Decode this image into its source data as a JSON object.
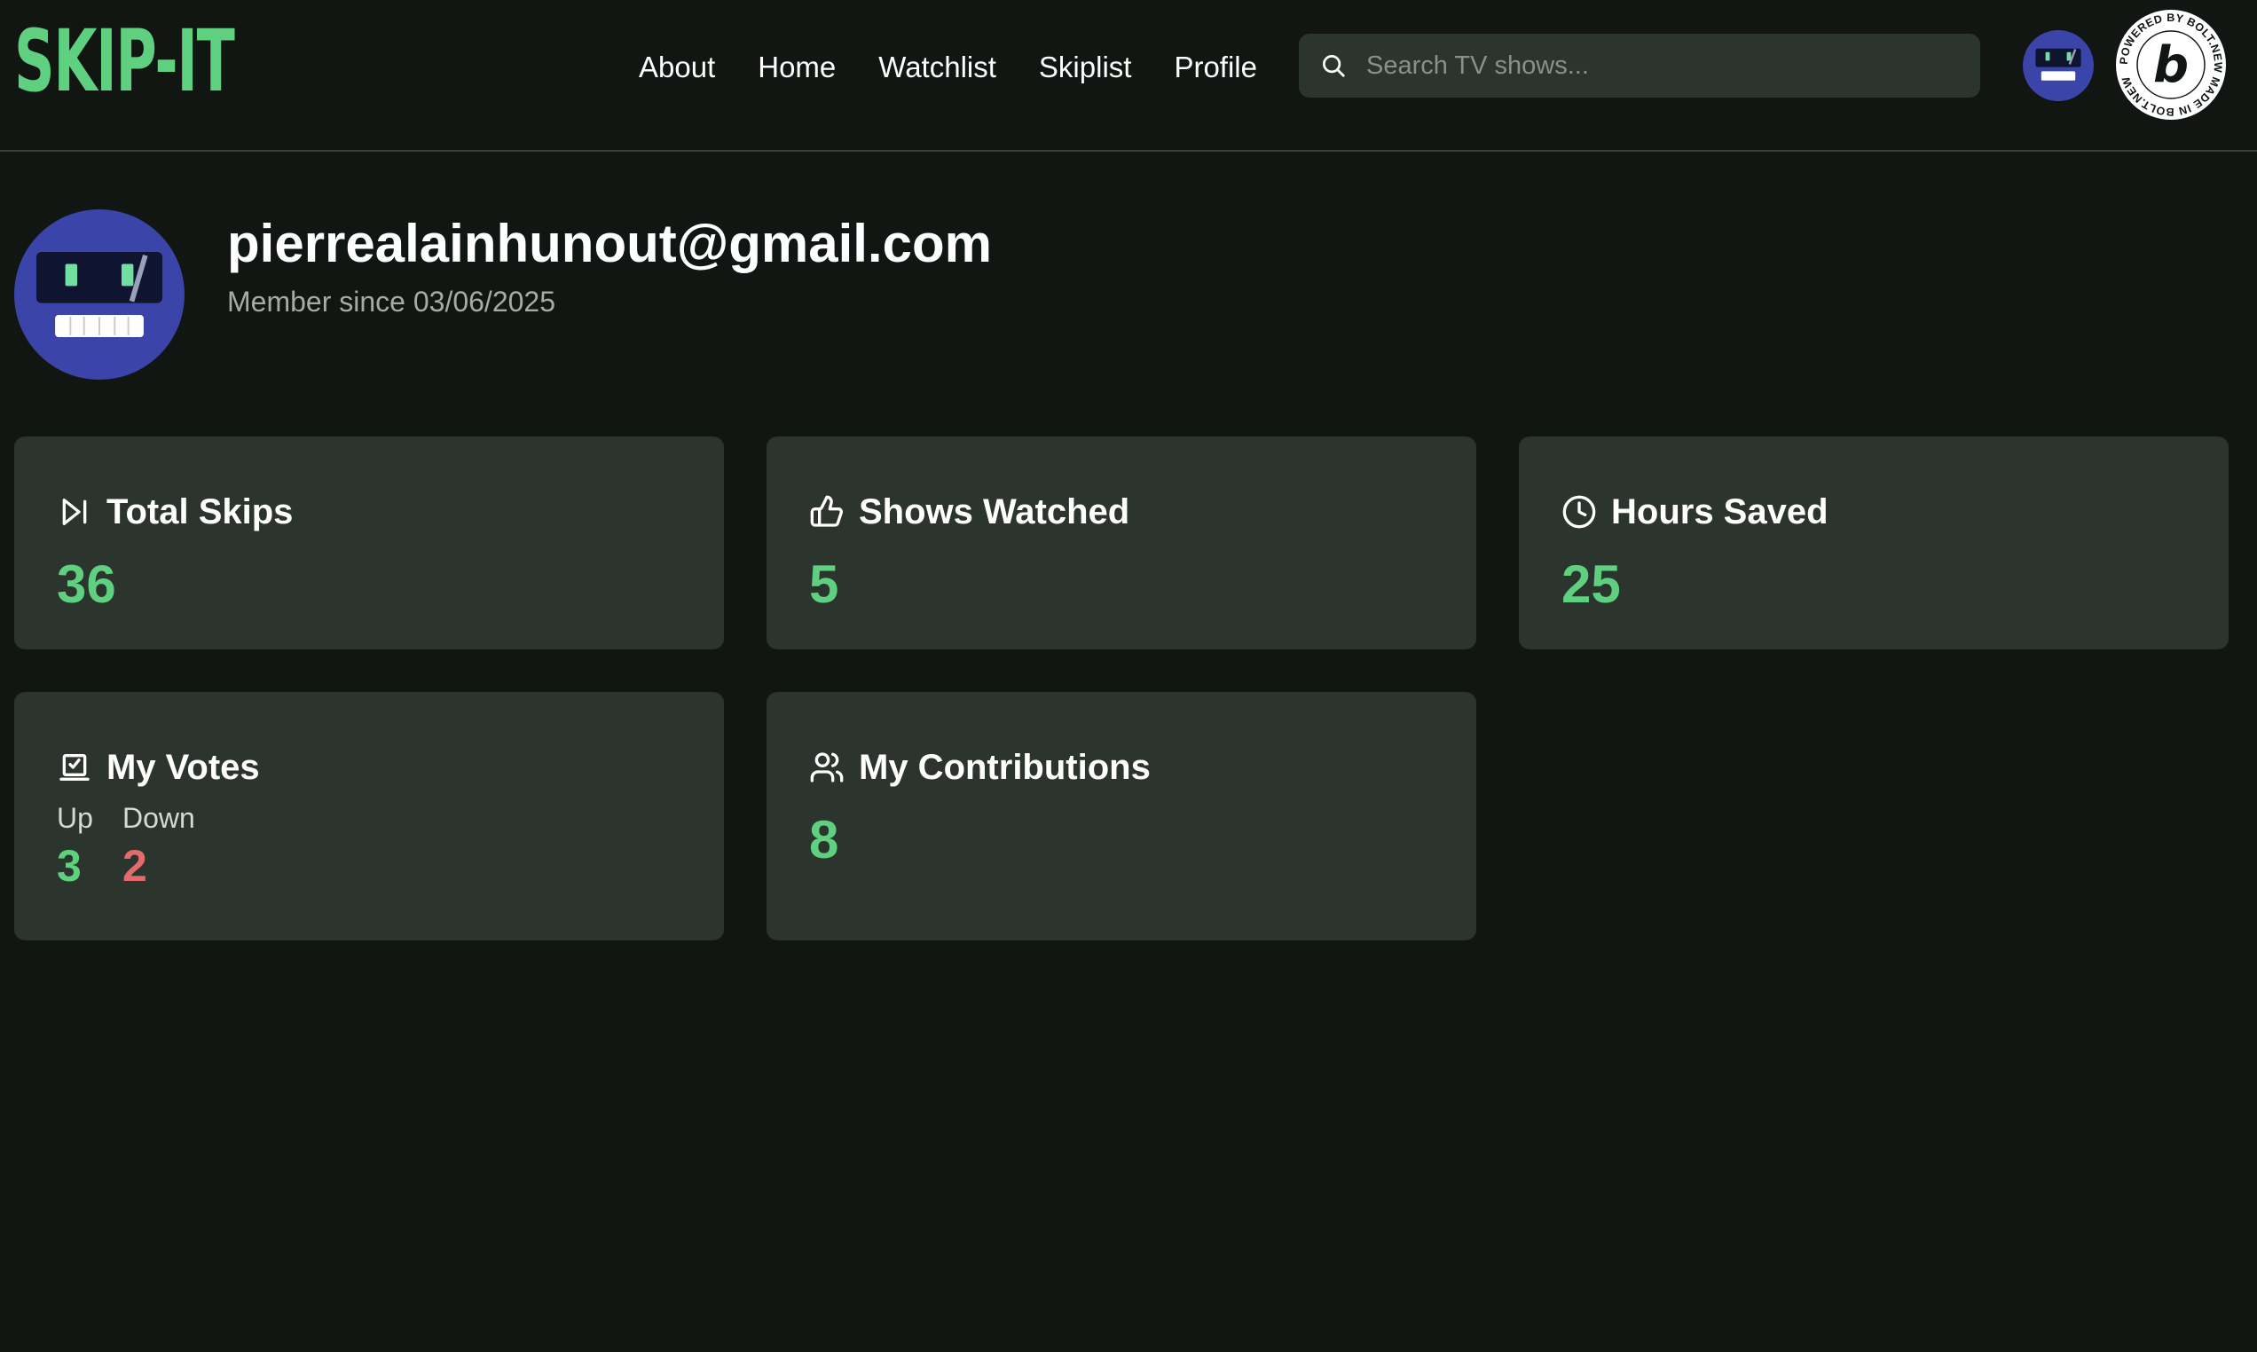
{
  "brand": {
    "logo_text": "SKIP-IT",
    "accent_color": "#5fd07f",
    "down_color": "#e36b6b"
  },
  "nav": {
    "items": [
      {
        "label": "About"
      },
      {
        "label": "Home"
      },
      {
        "label": "Watchlist"
      },
      {
        "label": "Skiplist"
      },
      {
        "label": "Profile"
      }
    ]
  },
  "search": {
    "placeholder": "Search TV shows...",
    "value": "",
    "icon": "search-icon"
  },
  "badge": {
    "text": "POWERED BY BOLT.NEW MADE IN BOLT.NEW",
    "letter": "b"
  },
  "profile": {
    "email": "pierrealainhunout@gmail.com",
    "member_since": "Member since 03/06/2025"
  },
  "stats": {
    "total_skips": {
      "label": "Total Skips",
      "value": "36",
      "icon": "skip-forward-icon"
    },
    "shows_watched": {
      "label": "Shows Watched",
      "value": "5",
      "icon": "thumbs-up-icon"
    },
    "hours_saved": {
      "label": "Hours Saved",
      "value": "25",
      "icon": "clock-icon"
    },
    "my_votes": {
      "label": "My Votes",
      "icon": "ballot-box-icon",
      "up_label": "Up",
      "down_label": "Down",
      "up_value": "3",
      "down_value": "2"
    },
    "my_contributions": {
      "label": "My Contributions",
      "value": "8",
      "icon": "users-icon"
    }
  }
}
